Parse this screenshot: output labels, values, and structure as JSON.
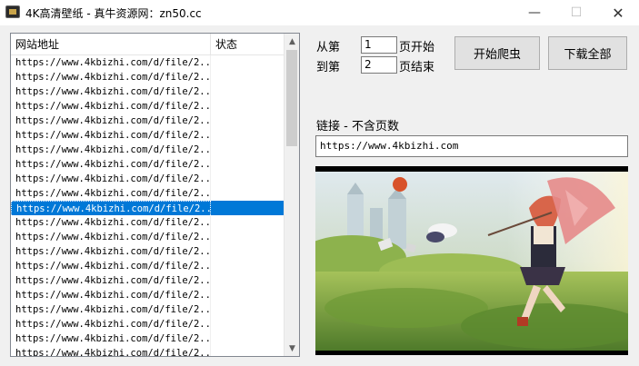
{
  "window": {
    "title": "4K高清壁纸 - 真牛资源网：zn50.cc",
    "min_glyph": "—",
    "max_glyph": "☐",
    "close_glyph": "✕"
  },
  "list": {
    "columns": [
      "网站地址",
      "状态"
    ],
    "rows": [
      {
        "url": "https://www.4kbizhi.com/d/file/2...",
        "status": ""
      },
      {
        "url": "https://www.4kbizhi.com/d/file/2...",
        "status": ""
      },
      {
        "url": "https://www.4kbizhi.com/d/file/2...",
        "status": ""
      },
      {
        "url": "https://www.4kbizhi.com/d/file/2...",
        "status": ""
      },
      {
        "url": "https://www.4kbizhi.com/d/file/2...",
        "status": ""
      },
      {
        "url": "https://www.4kbizhi.com/d/file/2...",
        "status": ""
      },
      {
        "url": "https://www.4kbizhi.com/d/file/2...",
        "status": ""
      },
      {
        "url": "https://www.4kbizhi.com/d/file/2...",
        "status": ""
      },
      {
        "url": "https://www.4kbizhi.com/d/file/2...",
        "status": ""
      },
      {
        "url": "https://www.4kbizhi.com/d/file/2...",
        "status": ""
      },
      {
        "url": "https://www.4kbizhi.com/d/file/2...",
        "status": ""
      },
      {
        "url": "https://www.4kbizhi.com/d/file/2...",
        "status": ""
      },
      {
        "url": "https://www.4kbizhi.com/d/file/2...",
        "status": ""
      },
      {
        "url": "https://www.4kbizhi.com/d/file/2...",
        "status": ""
      },
      {
        "url": "https://www.4kbizhi.com/d/file/2...",
        "status": ""
      },
      {
        "url": "https://www.4kbizhi.com/d/file/2...",
        "status": ""
      },
      {
        "url": "https://www.4kbizhi.com/d/file/2...",
        "status": ""
      },
      {
        "url": "https://www.4kbizhi.com/d/file/2...",
        "status": ""
      },
      {
        "url": "https://www.4kbizhi.com/d/file/2...",
        "status": ""
      },
      {
        "url": "https://www.4kbizhi.com/d/file/2...",
        "status": ""
      },
      {
        "url": "https://www.4kbizhi.com/d/file/2...",
        "status": ""
      }
    ],
    "selected_index": 10,
    "scroll_up_glyph": "▲",
    "scroll_down_glyph": "▼"
  },
  "controls": {
    "from_label": "从第",
    "from_value": "1",
    "start_suffix": "页开始",
    "to_label": "到第",
    "to_value": "2",
    "end_suffix": "页结束",
    "start_button": "开始爬虫",
    "download_button": "下载全部",
    "link_label": "链接 - 不含页数",
    "link_value": "https://www.4kbizhi.com"
  },
  "colors": {
    "selection": "#0078d7",
    "button_face": "#e1e1e1"
  }
}
